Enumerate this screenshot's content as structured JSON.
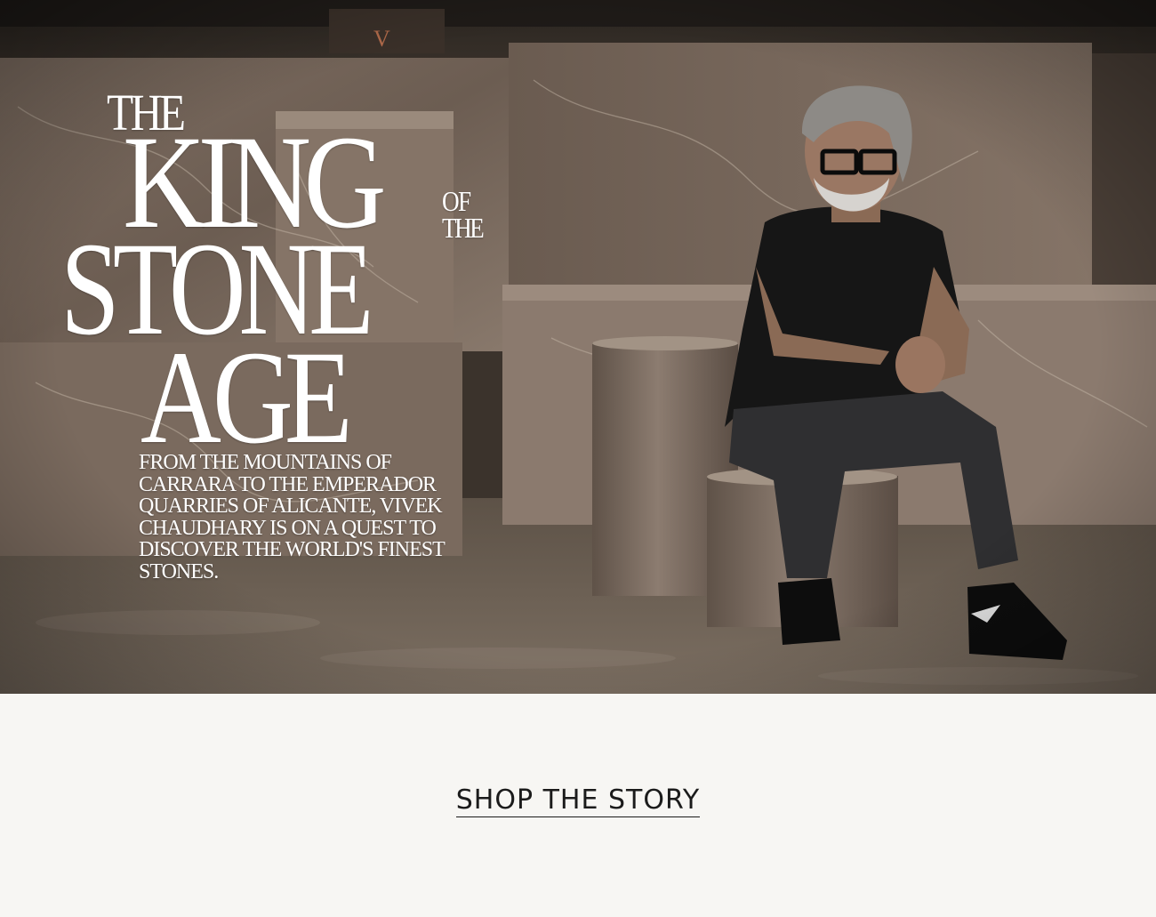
{
  "hero": {
    "headline": {
      "the_1": "THE",
      "king": "KING",
      "of": "OF",
      "the_2": "THE",
      "stone": "STONE",
      "age": "AGE"
    },
    "deck_text": "FROM THE MOUNTAINS OF CARRARA TO THE EMPERADOR QUARRIES OF ALICANTE, VIVEK CHAUDHARY IS ON A QUEST TO DISCOVER THE WORLD'S FINEST STONES.",
    "background_colors": {
      "stone": "#7a6a5e",
      "stone_dark": "#4e433b",
      "floor": "#6b5e52",
      "shirt": "#161616"
    }
  },
  "cta": {
    "label": "SHOP THE STORY"
  },
  "colors": {
    "page_bg": "#f7f6f3",
    "text": "#1b1b1b",
    "headline": "#ffffff"
  }
}
